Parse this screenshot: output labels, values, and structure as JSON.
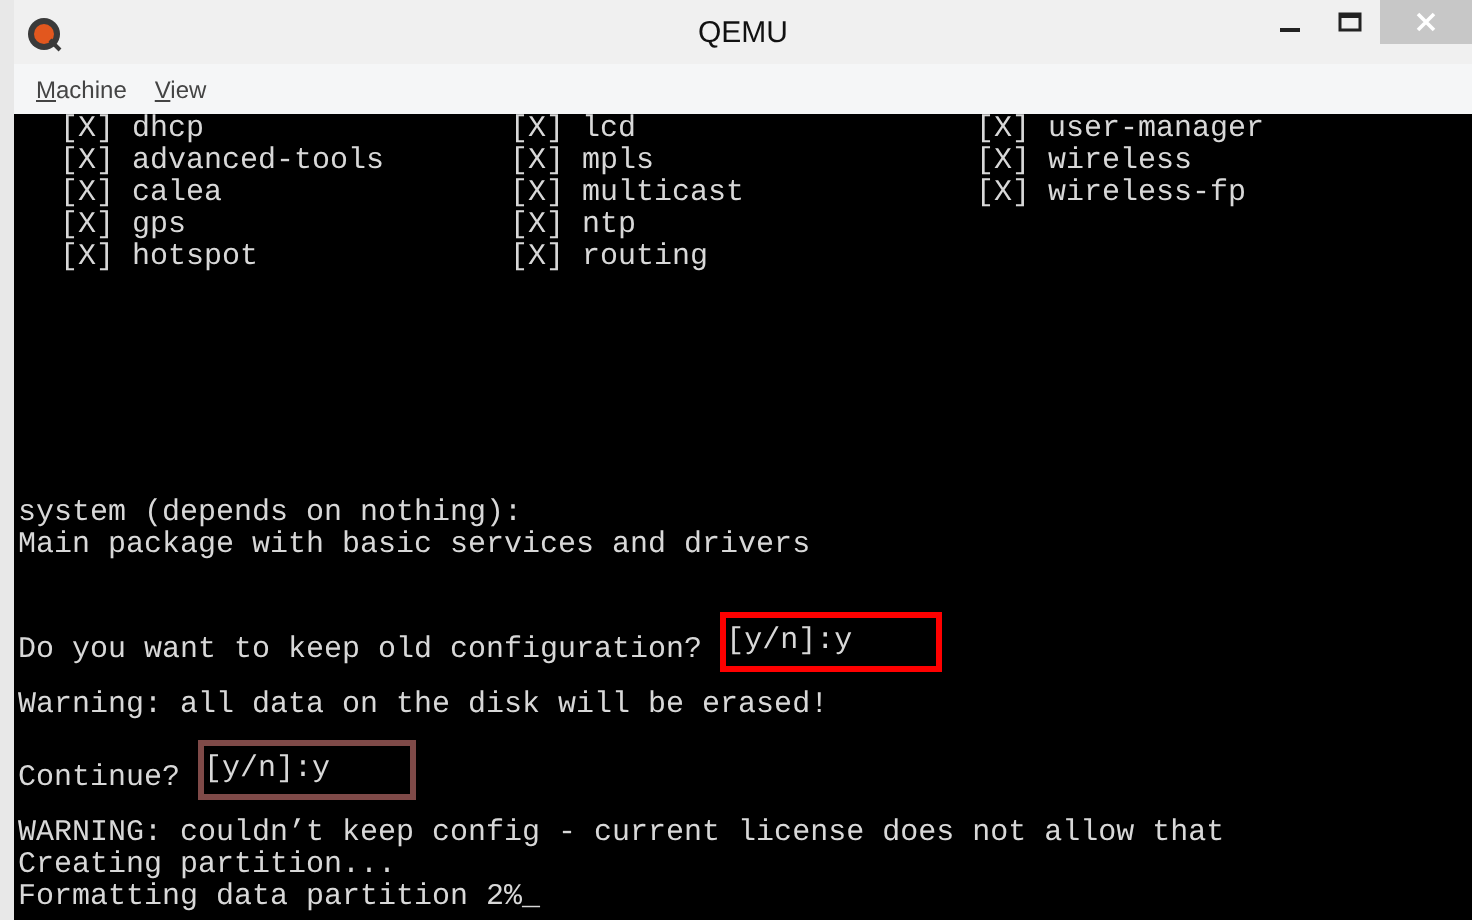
{
  "window": {
    "title": "QEMU"
  },
  "menu": [
    {
      "label": "Machine"
    },
    {
      "label": "View"
    }
  ],
  "terminal": {
    "package_rows": [
      [
        "[X] dhcp",
        "[X] lcd",
        "[X] user-manager"
      ],
      [
        "[X] advanced-tools",
        "[X] mpls",
        "[X] wireless"
      ],
      [
        "[X] calea",
        "[X] multicast",
        "[X] wireless-fp"
      ],
      [
        "[X] gps",
        "[X] ntp"
      ],
      [
        "[X] hotspot",
        "[X] routing"
      ]
    ],
    "package_description": [
      "system (depends on nothing):",
      "Main package with basic services and drivers"
    ],
    "messages": [
      {
        "kind": "prompt",
        "text": "Do you want to keep old configuration?",
        "answer": "[y/n]:y",
        "color": "#ff0000"
      },
      {
        "kind": "notice",
        "text": "Warning: all data on the disk will be erased!"
      },
      {
        "kind": "prompt",
        "text": "Continue?",
        "answer": "[y/n]:y",
        "color": "#7f4a48"
      }
    ],
    "output": [
      "WARNING: couldn’t keep config - current license does not allow that",
      "Creating partition...",
      "Formatting data partition 2%_"
    ]
  }
}
